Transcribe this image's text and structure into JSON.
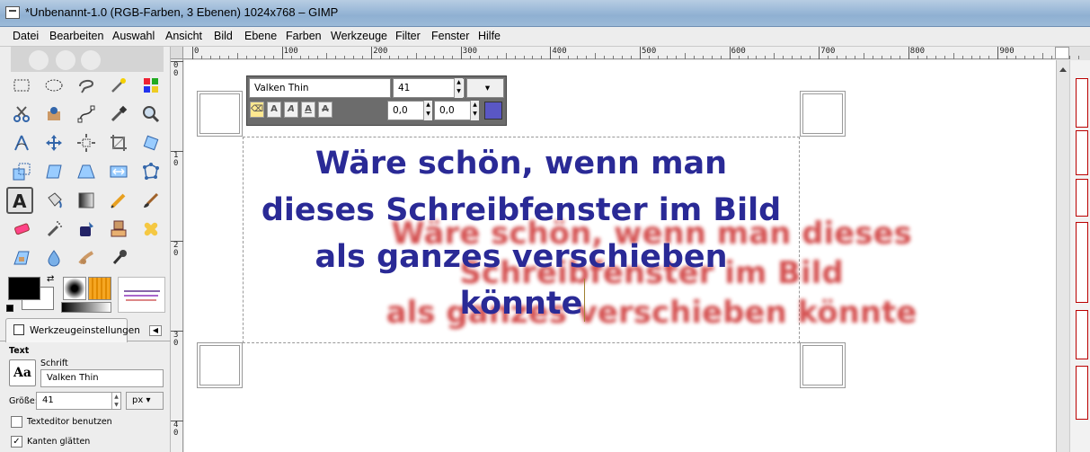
{
  "window": {
    "title": "*Unbenannt-1.0 (RGB-Farben, 3 Ebenen) 1024x768 – GIMP"
  },
  "menu": [
    "Datei",
    "Bearbeiten",
    "Auswahl",
    "Ansicht",
    "Bild",
    "Ebene",
    "Farben",
    "Werkzeuge",
    "Filter",
    "Fenster",
    "Hilfe"
  ],
  "ruler": {
    "h_labels": [
      "0",
      "100",
      "200",
      "300",
      "400",
      "500",
      "600",
      "700",
      "800",
      "900"
    ],
    "v_labels": [
      "0",
      "1",
      "2",
      "3",
      "4"
    ],
    "v_sub": [
      "0",
      "0",
      "0",
      "0",
      "0"
    ]
  },
  "tool_options": {
    "tab_label": "Werkzeugeinstellungen",
    "section": "Text",
    "font_label": "Schrift",
    "font_value": "Valken Thin",
    "size_label": "Größe:",
    "size_value": "41",
    "unit": "px",
    "use_editor_label": "Texteditor benutzen",
    "antialias_label": "Kanten glätten",
    "use_editor_checked": false,
    "antialias_checked": true,
    "font_icon_text": "Aa"
  },
  "text_toolbar": {
    "font": "Valken Thin",
    "size": "41",
    "baseline": "0,0",
    "kerning": "0,0",
    "color": "#5a57c4"
  },
  "canvas_text": {
    "blue_lines": [
      "Wäre  schön, wenn man",
      "dieses Schreibfenster im Bild",
      "als ganzes verschieben",
      "könnte"
    ],
    "red_lines": [
      "Wäre  schön, wenn man dieses",
      "Schreibfenster im Bild",
      "als ganzes verschieben könnte"
    ]
  },
  "colors": {
    "blue_text": "#2a2a96",
    "red_text": "#cc3030",
    "foreground": "#000000",
    "background": "#ffffff"
  }
}
